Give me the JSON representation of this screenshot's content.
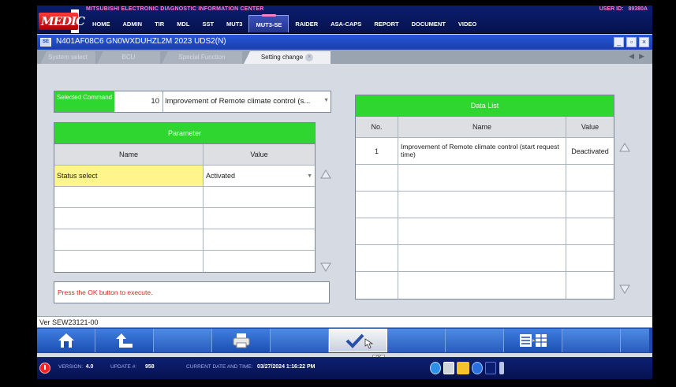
{
  "header": {
    "center_title": "MITSUBISHI ELECTRONIC DIAGNOSTIC INFORMATION CENTER",
    "user_label": "USER ID:",
    "user_id": "89380A",
    "logo_text": "MEDIC",
    "menu": [
      {
        "label": "HOME",
        "active": false
      },
      {
        "label": "ADMIN",
        "active": false
      },
      {
        "label": "TIR",
        "active": false
      },
      {
        "label": "MDL",
        "active": false
      },
      {
        "label": "SST",
        "active": false
      },
      {
        "label": "MUT3",
        "active": false
      },
      {
        "label": "MUT3-SE",
        "active": true
      },
      {
        "label": "RAIDER",
        "active": false
      },
      {
        "label": "ASA-CAPS",
        "active": false
      },
      {
        "label": "REPORT",
        "active": false
      },
      {
        "label": "DOCUMENT",
        "active": false
      },
      {
        "label": "VIDEO",
        "active": false
      }
    ]
  },
  "window": {
    "icon_text": "SE",
    "title": "N401AF08C6  GN0WXDUHZL2M 2023   UDS2(N)",
    "minimize": "_",
    "restore": "▫",
    "close": "×"
  },
  "tabs": [
    {
      "label": "System select",
      "active": false
    },
    {
      "label": "BCU",
      "active": false
    },
    {
      "label": "Special Function",
      "active": false
    },
    {
      "label": "Setting change",
      "active": true
    }
  ],
  "tab_close": "×",
  "tab_nav": {
    "prev": "◀",
    "next": "▶"
  },
  "selected_command": {
    "label": "Selected Command",
    "number": "10",
    "command": "Improvement of Remote climate control (s..."
  },
  "parameter": {
    "title": "Parameter",
    "col_name": "Name",
    "col_value": "Value",
    "rows": [
      {
        "name": "Status select",
        "value": "Activated"
      }
    ]
  },
  "message": "Press the OK button to execute.",
  "data_list": {
    "title": "Data List",
    "col_no": "No.",
    "col_name": "Name",
    "col_value": "Value",
    "rows": [
      {
        "no": "1",
        "name": "Improvement of Remote climate control (start request time)",
        "value": "Deactivated"
      }
    ]
  },
  "version_bar": "Ver SEW23121-00",
  "toolbar": {
    "buttons": [
      "home-icon",
      "back-icon",
      "empty",
      "print-icon",
      "empty",
      "ok-check-icon",
      "empty",
      "empty",
      "data-list-icon",
      "empty",
      "empty"
    ],
    "ok_tooltip": "OK"
  },
  "status_bar": {
    "version_label": "VERSION:",
    "version_value": "4.0",
    "update_label": "UPDATE #:",
    "update_value": "958",
    "datetime_label": "CURRENT DATE AND TIME:",
    "datetime_value": "03/27/2024 1:16:22 PM"
  },
  "colors": {
    "header_bg": "#0b1d6e",
    "window_bar": "#2457d6",
    "green_header": "#2fd62f",
    "highlight": "#fff58a",
    "message_text": "#e02020",
    "toolbar": "#1c4aa6"
  }
}
